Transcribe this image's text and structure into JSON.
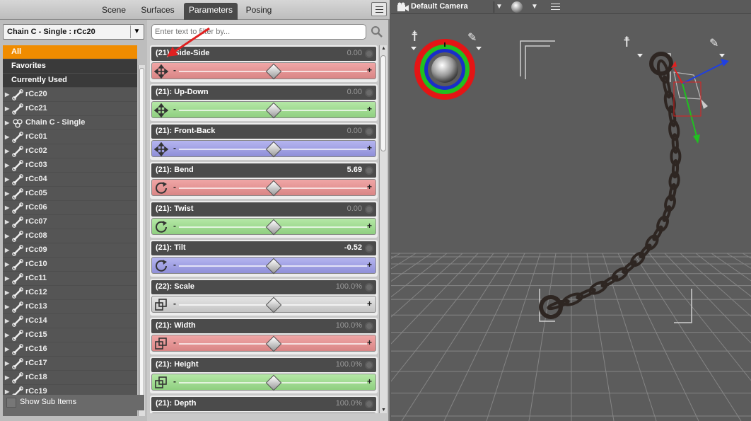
{
  "tabs": [
    {
      "label": "Scene",
      "active": false
    },
    {
      "label": "Surfaces",
      "active": false
    },
    {
      "label": "Parameters",
      "active": true
    },
    {
      "label": "Posing",
      "active": false
    }
  ],
  "node_selector": {
    "label": "Chain C - Single : rCc20"
  },
  "filter": {
    "placeholder": "Enter text to filter by..."
  },
  "node_list": {
    "filters": [
      "All",
      "Favorites",
      "Currently Used"
    ],
    "selected_filter": "All",
    "items": [
      {
        "label": "rCc20",
        "icon": "bone-icon"
      },
      {
        "label": "rCc21",
        "icon": "bone-icon"
      },
      {
        "label": "Chain C - Single",
        "icon": "figure-icon"
      },
      {
        "label": "rCc01",
        "icon": "bone-icon"
      },
      {
        "label": "rCc02",
        "icon": "bone-icon"
      },
      {
        "label": "rCc03",
        "icon": "bone-icon"
      },
      {
        "label": "rCc04",
        "icon": "bone-icon"
      },
      {
        "label": "rCc05",
        "icon": "bone-icon"
      },
      {
        "label": "rCc06",
        "icon": "bone-icon"
      },
      {
        "label": "rCc07",
        "icon": "bone-icon"
      },
      {
        "label": "rCc08",
        "icon": "bone-icon"
      },
      {
        "label": "rCc09",
        "icon": "bone-icon"
      },
      {
        "label": "rCc10",
        "icon": "bone-icon"
      },
      {
        "label": "rCc11",
        "icon": "bone-icon"
      },
      {
        "label": "rCc12",
        "icon": "bone-icon"
      },
      {
        "label": "rCc13",
        "icon": "bone-icon"
      },
      {
        "label": "rCc14",
        "icon": "bone-icon"
      },
      {
        "label": "rCc15",
        "icon": "bone-icon"
      },
      {
        "label": "rCc16",
        "icon": "bone-icon"
      },
      {
        "label": "rCc17",
        "icon": "bone-icon"
      },
      {
        "label": "rCc18",
        "icon": "bone-icon"
      },
      {
        "label": "rCc19",
        "icon": "bone-icon"
      }
    ],
    "show_sub_items": {
      "label": "Show Sub Items",
      "checked": false
    }
  },
  "parameters": [
    {
      "name": "(21): Side-Side",
      "value": "0.00",
      "changed": false,
      "tint": "red",
      "icon": "translate-icon",
      "knob_fraction": 0.5
    },
    {
      "name": "(21): Up-Down",
      "value": "0.00",
      "changed": false,
      "tint": "green",
      "icon": "translate-icon",
      "knob_fraction": 0.5
    },
    {
      "name": "(21): Front-Back",
      "value": "0.00",
      "changed": false,
      "tint": "blue",
      "icon": "translate-icon",
      "knob_fraction": 0.5
    },
    {
      "name": "(21): Bend",
      "value": "5.69",
      "changed": true,
      "tint": "red",
      "icon": "rotate-icon",
      "knob_fraction": 0.5
    },
    {
      "name": "(21): Twist",
      "value": "0.00",
      "changed": false,
      "tint": "green",
      "icon": "rotate-icon",
      "knob_fraction": 0.5
    },
    {
      "name": "(21): Tilt",
      "value": "-0.52",
      "changed": true,
      "tint": "blue",
      "icon": "rotate-icon",
      "knob_fraction": 0.5
    },
    {
      "name": "(22): Scale",
      "value": "100.0%",
      "changed": false,
      "tint": "gray",
      "icon": "scale-icon",
      "knob_fraction": 0.5
    },
    {
      "name": "(21): Width",
      "value": "100.0%",
      "changed": false,
      "tint": "red",
      "icon": "scale-icon",
      "knob_fraction": 0.5
    },
    {
      "name": "(21): Height",
      "value": "100.0%",
      "changed": false,
      "tint": "green",
      "icon": "scale-icon",
      "knob_fraction": 0.5
    },
    {
      "name": "(21): Depth",
      "value": "100.0%",
      "changed": false,
      "tint": "blue",
      "icon": "scale-icon",
      "knob_fraction": 0.5
    }
  ],
  "slider_minus": "-",
  "slider_plus": "+",
  "viewport": {
    "camera_label": "Default Camera"
  },
  "colors": {
    "selected_filter": "#f08c00",
    "annotation_arrow": "#e02020",
    "x_axis": "#e02020",
    "y_axis": "#20c020",
    "z_axis": "#2040e0"
  }
}
